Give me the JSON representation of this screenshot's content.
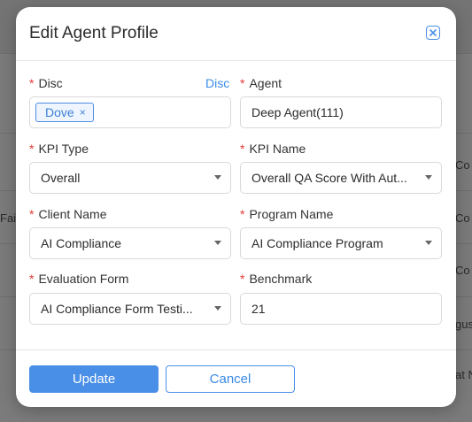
{
  "modal": {
    "title": "Edit Agent Profile",
    "close_icon": "close-square-icon"
  },
  "form": {
    "disc": {
      "label": "Disc",
      "link": "Disc",
      "tags": [
        {
          "label": "Dove",
          "remove": "×"
        }
      ]
    },
    "agent": {
      "label": "Agent",
      "value": "Deep Agent(111)"
    },
    "kpi_type": {
      "label": "KPI Type",
      "value": "Overall"
    },
    "kpi_name": {
      "label": "KPI Name",
      "value": "Overall QA Score With Aut..."
    },
    "client_name": {
      "label": "Client Name",
      "value": "AI Compliance"
    },
    "program_name": {
      "label": "Program Name",
      "value": "AI Compliance Program"
    },
    "evaluation_form": {
      "label": "Evaluation Form",
      "value": "AI Compliance Form Testi..."
    },
    "benchmark": {
      "label": "Benchmark",
      "value": "21"
    },
    "required_marker": "*"
  },
  "footer": {
    "update_label": "Update",
    "cancel_label": "Cancel"
  },
  "background": {
    "row_fragments": [
      "Co",
      "Fai",
      "Co",
      "Co",
      "gus",
      "at N"
    ]
  },
  "colors": {
    "accent": "#4a8fe7",
    "required": "#e53935",
    "overlay": "#7a7a7a"
  }
}
